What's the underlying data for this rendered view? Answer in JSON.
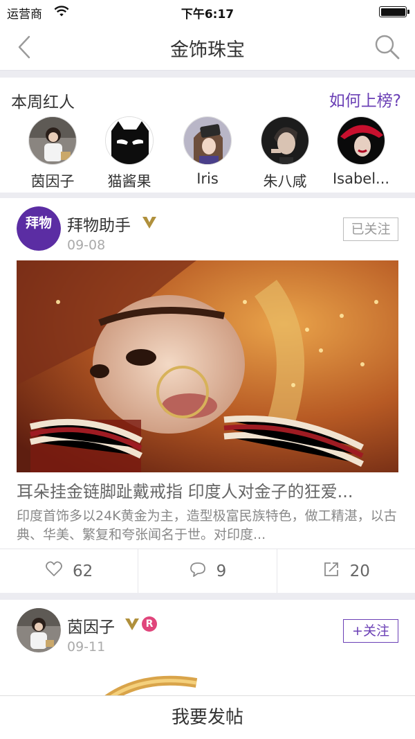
{
  "status_bar": {
    "carrier": "运营商",
    "time": "下午6:17",
    "wifi_icon": "wifi-icon",
    "battery_icon": "battery-icon"
  },
  "nav": {
    "title": "金饰珠宝",
    "back_icon": "back-chevron-icon",
    "search_icon": "search-icon"
  },
  "hot": {
    "heading": "本周红人",
    "link": "如何上榜?",
    "people": [
      {
        "name": "茵因子"
      },
      {
        "name": "猫酱果"
      },
      {
        "name": "Iris"
      },
      {
        "name": "朱八咸"
      },
      {
        "name": "Isabel..."
      }
    ]
  },
  "posts": [
    {
      "author": "拜物助手",
      "avatar_text": "拜物",
      "date": "09-08",
      "follow_label": "已关注",
      "verified_icon": "verified-v-icon",
      "title": "耳朵挂金链脚趾戴戒指 印度人对金子的狂爱...",
      "excerpt": "印度首饰多以24K黄金为主，造型极富民族特色，做工精湛，以古典、华美、繁复和夸张闻名于世。对印度...",
      "likes": "62",
      "comments": "9",
      "shares": "20"
    },
    {
      "author": "茵因子",
      "date": "09-11",
      "follow_label": "+关注",
      "verified_icon": "verified-v-icon",
      "badge": "R"
    }
  ],
  "bottom": {
    "post_label": "我要发帖"
  },
  "colors": {
    "accent": "#6a3fb5",
    "badge_gold": "#b0903c",
    "badge_pink": "#e0457b",
    "background": "#ececf1"
  }
}
